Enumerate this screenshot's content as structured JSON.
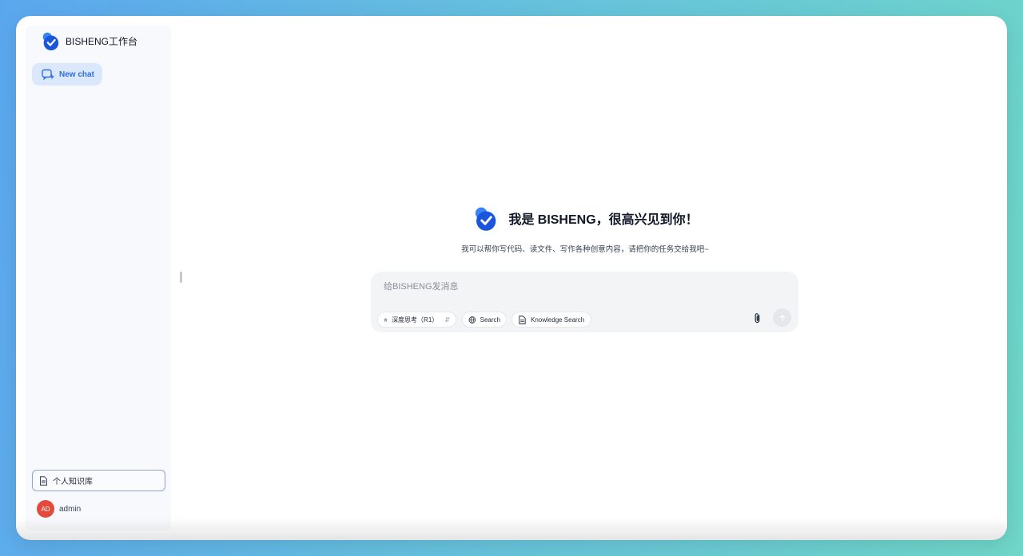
{
  "sidebar": {
    "brand_title": "BISHENG工作台",
    "new_chat_label": "New chat",
    "knowledge_label": "个人知识库",
    "user": {
      "initials": "AD",
      "name": "admin"
    }
  },
  "hero": {
    "title": "我是 BISHENG，很高兴见到你！",
    "subtitle": "我可以帮你写代码、读文件、写作各种创意内容，请把你的任务交给我吧~"
  },
  "composer": {
    "placeholder": "给BISHENG发消息",
    "value": "",
    "chips": {
      "deep_think": "深度思考（R1）",
      "search": "Search",
      "knowledge_search": "Knowledge Search"
    }
  },
  "colors": {
    "brand_blue": "#1a56db",
    "brand_light": "#3b82f6",
    "accent_text": "#2f6fe0",
    "avatar_bg": "#e24a3b",
    "background_gradient": [
      "#5ba7ee",
      "#6fd6c8"
    ]
  },
  "icons": [
    "bisheng-logo",
    "new-chat-icon",
    "document-icon",
    "deep-think-icon",
    "globe-icon",
    "file-icon",
    "paperclip-icon",
    "send-arrow-icon"
  ]
}
